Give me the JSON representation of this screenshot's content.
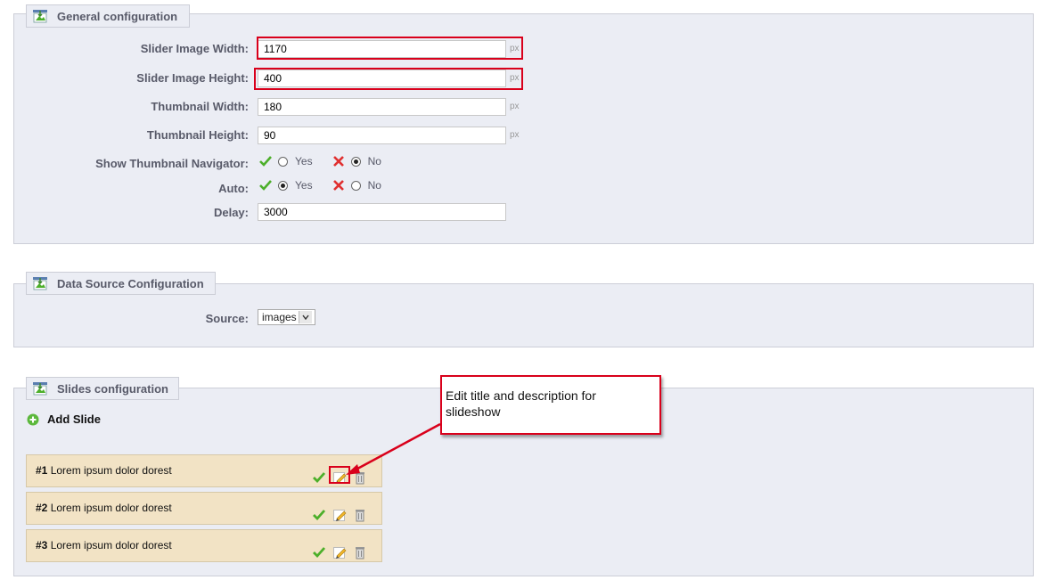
{
  "general": {
    "legend": "General configuration",
    "fields": {
      "slider_width": {
        "label": "Slider Image Width:",
        "value": "1170",
        "unit": "px"
      },
      "slider_height": {
        "label": "Slider Image Height:",
        "value": "400",
        "unit": "px"
      },
      "thumb_width": {
        "label": "Thumbnail Width:",
        "value": "180",
        "unit": "px"
      },
      "thumb_height": {
        "label": "Thumbnail Height:",
        "value": "90",
        "unit": "px"
      },
      "show_nav": {
        "label": "Show Thumbnail Navigator:",
        "yes": "Yes",
        "no": "No",
        "selected": "No"
      },
      "auto": {
        "label": "Auto:",
        "yes": "Yes",
        "no": "No",
        "selected": "Yes"
      },
      "delay": {
        "label": "Delay:",
        "value": "3000"
      }
    }
  },
  "datasource": {
    "legend": "Data Source Configuration",
    "source_label": "Source:",
    "source_value": "images"
  },
  "slides": {
    "legend": "Slides configuration",
    "add_label": "Add Slide",
    "items": [
      {
        "num": "#1",
        "title": "Lorem ipsum dolor dorest"
      },
      {
        "num": "#2",
        "title": "Lorem ipsum dolor dorest"
      },
      {
        "num": "#3",
        "title": "Lorem ipsum dolor dorest"
      }
    ]
  },
  "annotation": {
    "text": "Edit title and description for slideshow"
  },
  "colors": {
    "panel_bg": "#ebedf4",
    "slide_bg": "#f2e3c5",
    "highlight": "#d9001b",
    "check_green": "#4caf2a",
    "cross_red": "#e03030"
  },
  "icons": [
    "config-legend-icon",
    "check-icon",
    "cross-icon",
    "add-icon",
    "edit-icon",
    "delete-icon"
  ]
}
